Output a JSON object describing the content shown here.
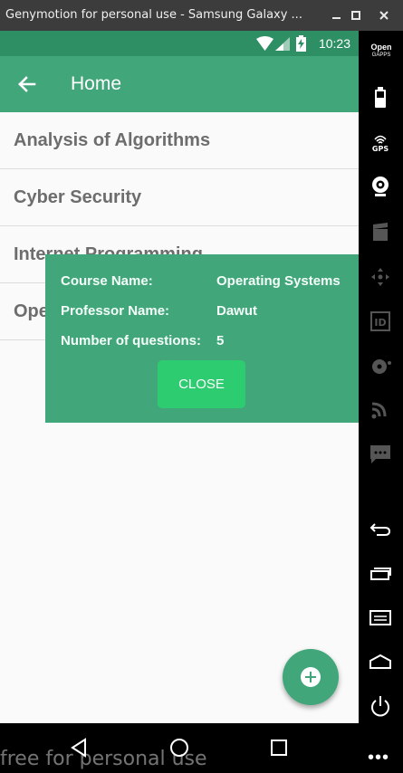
{
  "window": {
    "title": "Genymotion for personal use - Samsung Galaxy ...",
    "minimize_icon": "minimize-icon",
    "maximize_icon": "maximize-icon",
    "close_icon": "close-icon"
  },
  "status_bar": {
    "time": "10:23",
    "icons": [
      "wifi-icon",
      "signal-icon",
      "battery-charging-icon"
    ]
  },
  "app_bar": {
    "back_icon": "arrow-back-icon",
    "title": "Home"
  },
  "courses": [
    {
      "name": "Analysis of Algorithms"
    },
    {
      "name": "Cyber Security"
    },
    {
      "name": "Internet Programming"
    },
    {
      "name": "Operating Systems"
    }
  ],
  "dialog": {
    "course_label": "Course Name:",
    "course_value": "Operating Systems",
    "professor_label": "Professor Name:",
    "professor_value": "Dawut",
    "questions_label": "Number of questions:",
    "questions_value": "5",
    "close_label": "CLOSE"
  },
  "fab": {
    "icon": "add-circle-icon"
  },
  "side_toolbar": {
    "open_gapps_line1": "Open",
    "open_gapps_line2": "GAPPS",
    "gps_label": "GPS",
    "tools": [
      "open-gapps-icon",
      "battery-icon",
      "gps-icon",
      "webcam-icon",
      "media-icon",
      "dpad-icon",
      "identifiers-icon",
      "disk-icon",
      "rss-icon",
      "sms-icon",
      "back-icon",
      "recent-apps-icon",
      "menu-icon",
      "home-icon",
      "power-icon"
    ]
  },
  "nav_bar": {
    "icons": [
      "nav-back-icon",
      "nav-home-icon",
      "nav-recents-icon",
      "more-icon"
    ],
    "more_label": "•••"
  },
  "watermark": "free for personal use",
  "colors": {
    "primary": "#42a67b",
    "primary_dark": "#2f8f64",
    "accent": "#2ecc71",
    "list_text": "#6d6d6d"
  }
}
